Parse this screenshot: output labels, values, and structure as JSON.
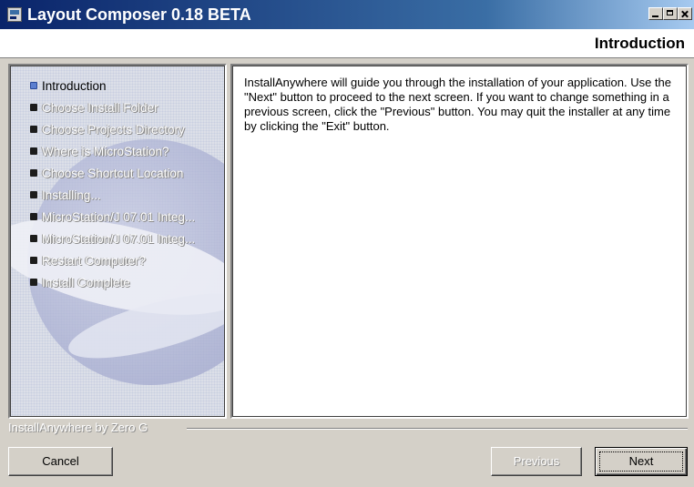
{
  "window": {
    "title": "Layout Composer 0.18 BETA",
    "icon": "installer-app-icon",
    "controls": [
      "minimize-icon",
      "maximize-icon",
      "close-icon"
    ]
  },
  "header": {
    "step_title": "Introduction"
  },
  "steps": {
    "items": [
      {
        "label": "Introduction",
        "active": true
      },
      {
        "label": "Choose Install Folder",
        "active": false
      },
      {
        "label": "Choose Projects Directory",
        "active": false
      },
      {
        "label": "Where is MicroStation?",
        "active": false
      },
      {
        "label": "Choose Shortcut Location",
        "active": false
      },
      {
        "label": "Installing...",
        "active": false
      },
      {
        "label": "MicroStation/J 07.01 Integ...",
        "active": false
      },
      {
        "label": "MicroStation/J 07.01 Integ...",
        "active": false
      },
      {
        "label": "Restart Computer?",
        "active": false
      },
      {
        "label": "Install Complete",
        "active": false
      }
    ]
  },
  "content": {
    "intro_text": "InstallAnywhere will guide you through the installation of your application. Use the \"Next\" button to proceed to the next screen. If you want to change something in a previous screen, click the \"Previous\" button. You may quit the installer at any time by clicking the \"Exit\" button."
  },
  "footer": {
    "brand": "InstallAnywhere by Zero G",
    "cancel_label": "Cancel",
    "previous_label": "Previous",
    "next_label": "Next"
  },
  "colors": {
    "titlebar_start": "#0a246a",
    "titlebar_end": "#a6caf0",
    "active_bullet": "#5b7fd0"
  }
}
